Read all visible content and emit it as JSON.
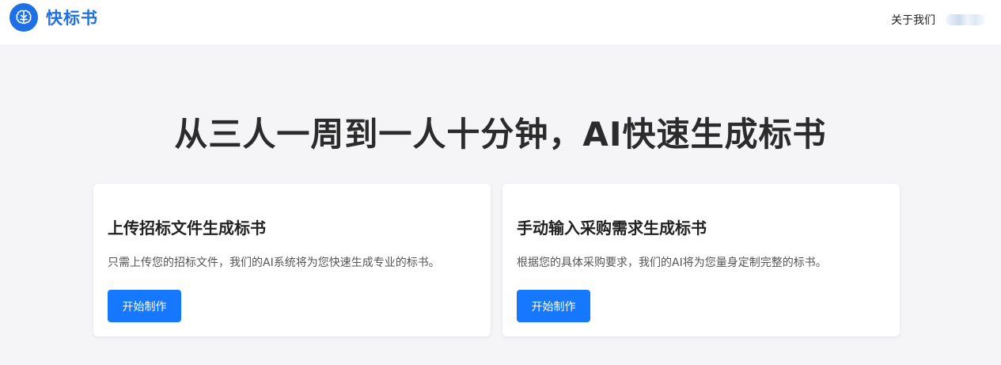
{
  "header": {
    "logo_text": "快标书",
    "about_link": "关于我们",
    "brand_color": "#1f6fe5"
  },
  "hero": {
    "title": "从三人一周到一人十分钟，AI快速生成标书"
  },
  "cards": [
    {
      "title": "上传招标文件生成标书",
      "description": "只需上传您的招标文件，我们的AI系统将为您快速生成专业的标书。",
      "button_label": "开始制作"
    },
    {
      "title": "手动输入采购需求生成标书",
      "description": "根据您的具体采购要求，我们的AI将为您量身定制完整的标书。",
      "button_label": "开始制作"
    }
  ],
  "colors": {
    "accent": "#1677ff",
    "page_background": "#f5f5f7"
  }
}
